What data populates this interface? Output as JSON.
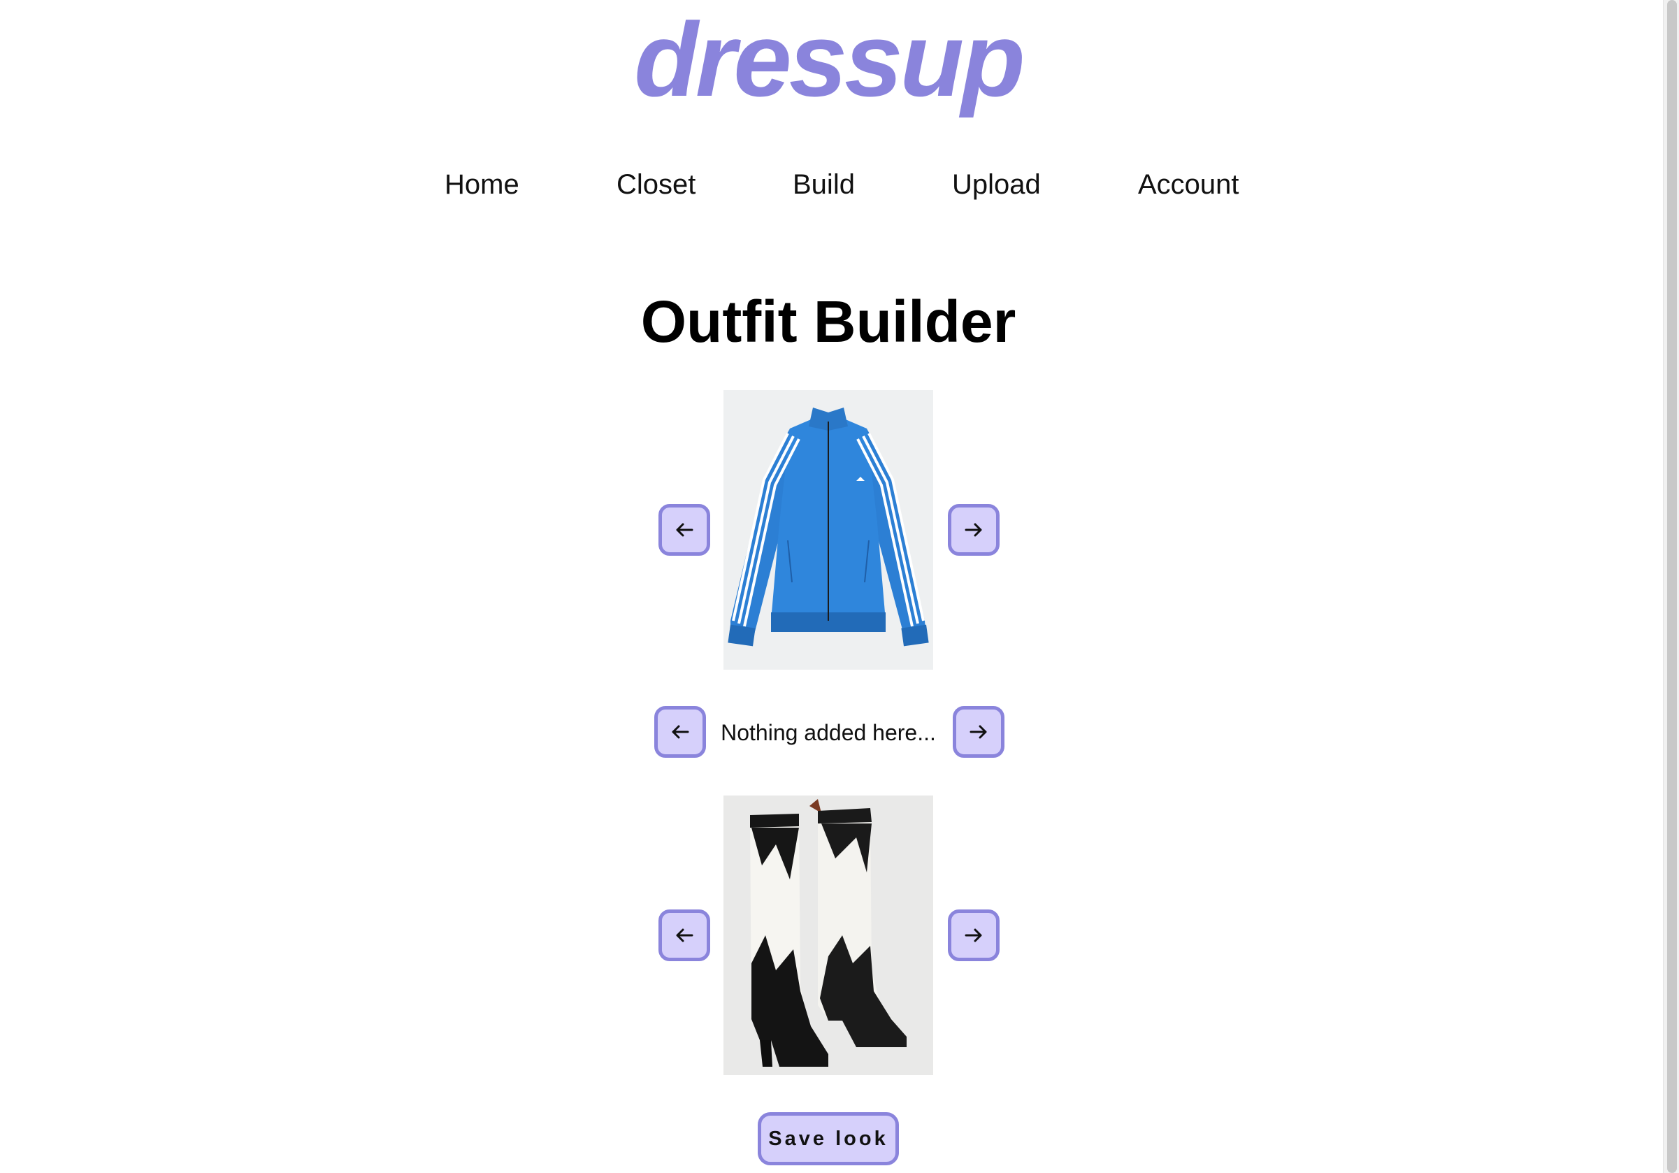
{
  "app": {
    "logo_text": "dressup",
    "brand_color": "#8a84dc",
    "button_fill": "#d6d0fb"
  },
  "nav": {
    "items": [
      {
        "label": "Home"
      },
      {
        "label": "Closet"
      },
      {
        "label": "Build"
      },
      {
        "label": "Upload"
      },
      {
        "label": "Account"
      }
    ]
  },
  "main": {
    "title": "Outfit Builder",
    "rows": [
      {
        "kind": "image",
        "item": "blue track jacket",
        "prev_icon": "arrow-left-icon",
        "next_icon": "arrow-right-icon"
      },
      {
        "kind": "empty",
        "empty_text": "Nothing added here...",
        "prev_icon": "arrow-left-icon",
        "next_icon": "arrow-right-icon"
      },
      {
        "kind": "image",
        "item": "black and white western boots",
        "prev_icon": "arrow-left-icon",
        "next_icon": "arrow-right-icon"
      }
    ],
    "save_label": "Save look"
  }
}
